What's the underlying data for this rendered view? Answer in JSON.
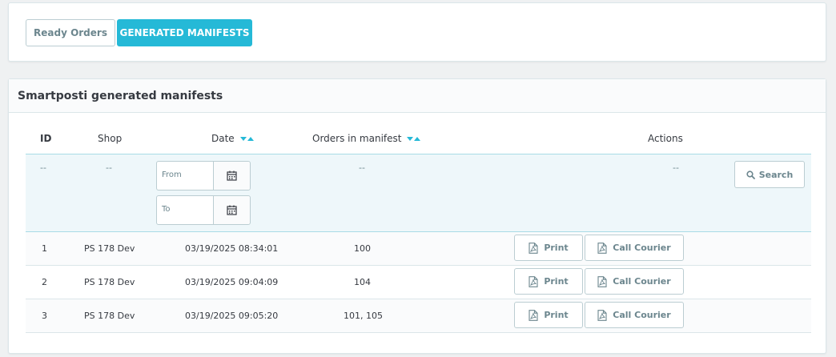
{
  "tabs": [
    {
      "label": "Ready Orders",
      "active": false
    },
    {
      "label": "GENERATED MANIFESTS",
      "active": true
    }
  ],
  "panel": {
    "title": "Smartposti generated manifests"
  },
  "table": {
    "headers": {
      "id": "ID",
      "shop": "Shop",
      "date": "Date",
      "orders": "Orders in manifest",
      "actions": "Actions"
    },
    "filters": {
      "id": "--",
      "shop": "--",
      "date_from_placeholder": "From",
      "date_to_placeholder": "To",
      "orders": "--",
      "actions": "--",
      "search_label": "Search"
    },
    "rows": [
      {
        "id": "1",
        "shop": "PS 178 Dev",
        "date": "03/19/2025 08:34:01",
        "orders": "100"
      },
      {
        "id": "2",
        "shop": "PS 178 Dev",
        "date": "03/19/2025 09:04:09",
        "orders": "104"
      },
      {
        "id": "3",
        "shop": "PS 178 Dev",
        "date": "03/19/2025 09:05:20",
        "orders": "101, 105"
      }
    ],
    "row_actions": {
      "print_label": "Print",
      "courier_label": "Call Courier"
    }
  },
  "colors": {
    "accent": "#25b9d7",
    "border": "#bbcdd2",
    "text": "#363a41",
    "muted": "#6c868e"
  },
  "icons": {
    "calendar": "calendar-icon",
    "search": "search-icon",
    "pdf": "pdf-file-icon"
  }
}
